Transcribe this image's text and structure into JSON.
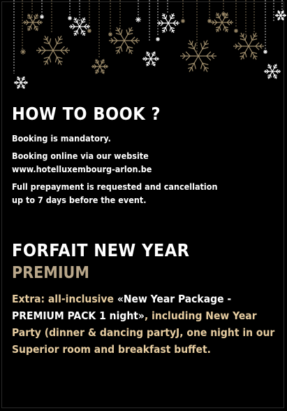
{
  "colors": {
    "background": "#000000",
    "gold": "#b9a78a",
    "text": "#ffffff",
    "accent_text": "#e6cca0"
  },
  "decorations": [
    "snowflake-icon",
    "star-icon"
  ],
  "how_to_book": {
    "title": "HOW TO BOOK ?",
    "line1": "Booking is mandatory.",
    "line2a": "Booking online via our website",
    "line2b": "www.hotelluxembourg-arlon.be",
    "line3a": "Full prepayment is requested and cancellation",
    "line3b": "up to 7 days before the event."
  },
  "forfait": {
    "title": "FORFAIT NEW YEAR",
    "subtitle": "PREMIUM",
    "desc_part1": "Extra: all-inclusive ",
    "desc_quote": "«New Year Package - PREMIUM PACK 1 night»",
    "desc_part2": ", including New Year Party (dinner & dancing partyJ, one night in our Superior room and breakfast buffet."
  }
}
